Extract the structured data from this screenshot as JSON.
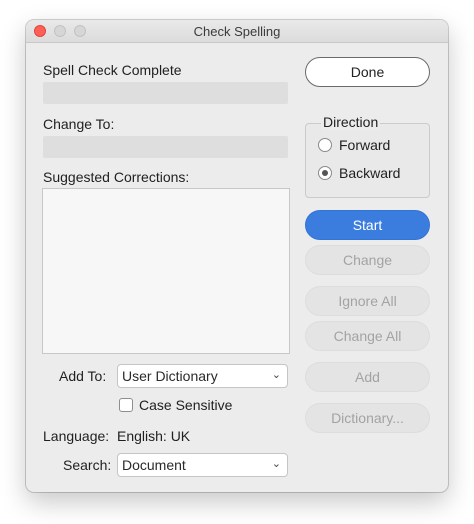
{
  "window": {
    "title": "Check Spelling"
  },
  "status": {
    "label": "Spell Check Complete",
    "value": ""
  },
  "change_to": {
    "label": "Change To:",
    "value": ""
  },
  "suggestions": {
    "label": "Suggested Corrections:",
    "items": []
  },
  "add_to": {
    "label": "Add To:",
    "selected": "User Dictionary"
  },
  "case_sensitive": {
    "label": "Case Sensitive",
    "checked": false
  },
  "language": {
    "label": "Language:",
    "value": "English: UK"
  },
  "search": {
    "label": "Search:",
    "selected": "Document"
  },
  "direction": {
    "label": "Direction",
    "options": [
      "Forward",
      "Backward"
    ],
    "selected": "Backward"
  },
  "buttons": {
    "done": "Done",
    "start": "Start",
    "change": "Change",
    "ignore_all": "Ignore All",
    "change_all": "Change All",
    "add": "Add",
    "dictionary": "Dictionary..."
  },
  "colors": {
    "accent": "#3a7ddf",
    "close": "#fe5f57"
  },
  "icons": {
    "select_chevron": "chevron-down-icon"
  }
}
